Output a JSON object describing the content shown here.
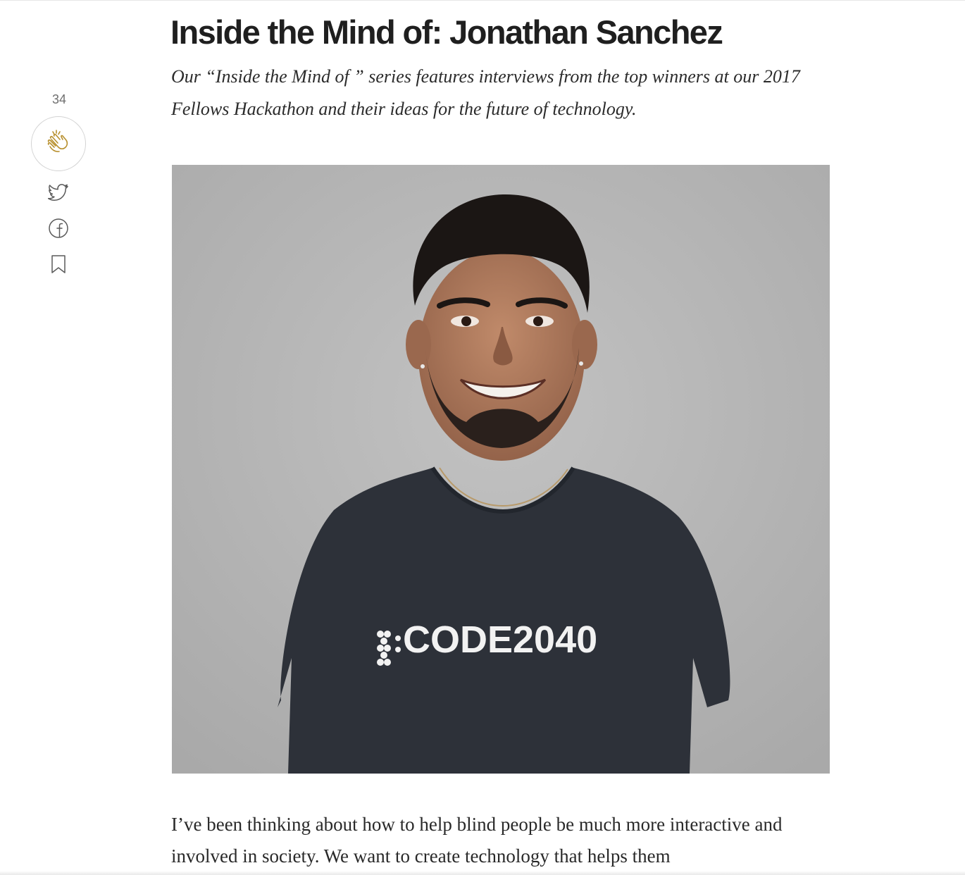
{
  "article": {
    "title": "Inside the Mind of: Jonathan Sanchez",
    "subtitle": "Our “Inside the Mind of ” series features interviews from the top winners at our 2017 Fellows Hackathon and their ideas for the future of technology.",
    "image": {
      "shirt_text": "CODE2040"
    },
    "body": "I’ve been thinking about how to help blind people be much more interactive and involved in society. We want to create technology that helps them"
  },
  "actions": {
    "clap_count": "34",
    "icons": [
      "clap-icon",
      "twitter-icon",
      "facebook-icon",
      "bookmark-icon"
    ]
  },
  "colors": {
    "clap_accent": "#b8902e",
    "icon_gray": "#5a5a5a"
  }
}
